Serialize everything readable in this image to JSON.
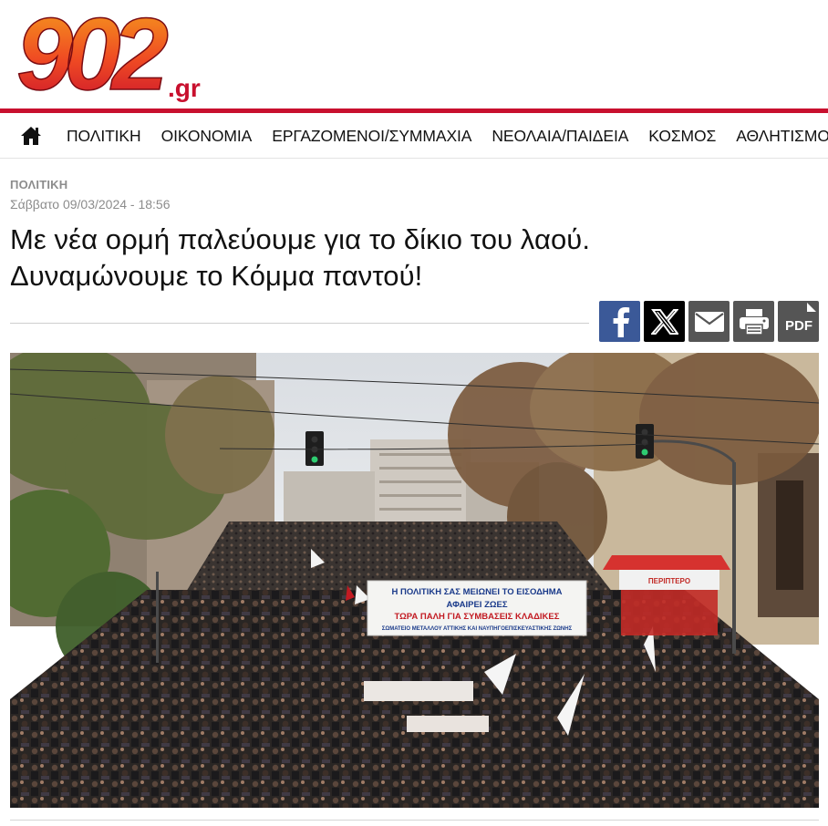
{
  "site": {
    "logo_number": "902",
    "logo_suffix": ".gr",
    "brand_red": "#c8102e",
    "brand_orange": "#f39c1a"
  },
  "nav": {
    "home_icon": "home-icon",
    "items": [
      {
        "label": "ΠΟΛΙΤΙΚΗ"
      },
      {
        "label": "ΟΙΚΟΝΟΜΙΑ"
      },
      {
        "label": "ΕΡΓΑΖΟΜΕΝΟΙ/ΣΥΜΜΑΧΙΑ"
      },
      {
        "label": "ΝΕΟΛΑΙΑ/ΠΑΙΔΕΙΑ"
      },
      {
        "label": "ΚΟΣΜΟΣ"
      },
      {
        "label": "ΑΘΛΗΤΙΣΜΟΣ"
      }
    ]
  },
  "article": {
    "category": "ΠΟΛΙΤΙΚΗ",
    "date": "Σάββατο 09/03/2024 - 18:56",
    "title_line1": "Με νέα ορμή παλεύουμε για το δίκιο του λαού.",
    "title_line2": "Δυναμώνουμε το Κόμμα παντού!"
  },
  "share": {
    "buttons": [
      {
        "icon": "facebook-icon",
        "color": "#3b5998"
      },
      {
        "icon": "x-icon",
        "color": "#000000"
      },
      {
        "icon": "mail-icon",
        "color": "#555555"
      },
      {
        "icon": "print-icon",
        "color": "#555555"
      },
      {
        "icon": "pdf-icon",
        "color": "#555555",
        "label": "PDF"
      }
    ]
  },
  "photo": {
    "banner_line1": "Η ΠΟΛΙΤΙΚΗ ΣΑΣ ΜΕΙΩΝΕΙ ΤΟ ΕΙΣΟΔΗΜΑ",
    "banner_line2": "ΑΦΑΙΡΕΙ ΖΩΕΣ",
    "banner_line3": "ΤΩΡΑ ΠΑΛΗ ΓΙΑ ΣΥΜΒΑΣΕΙΣ ΚΛΑΔΙΚΕΣ",
    "banner_line4": "ΣΩΜΑΤΕΙΟ ΜΕΤΑΛΛΟΥ ΑΤΤΙΚΗΣ ΚΑΙ ΝΑΥΠΗΓΟΕΠΙΣΚΕΥΑΣΤΙΚΗΣ ΖΩΝΗΣ",
    "kiosk_label": "ΠΕΡΙΠΤΕΡΟ"
  }
}
